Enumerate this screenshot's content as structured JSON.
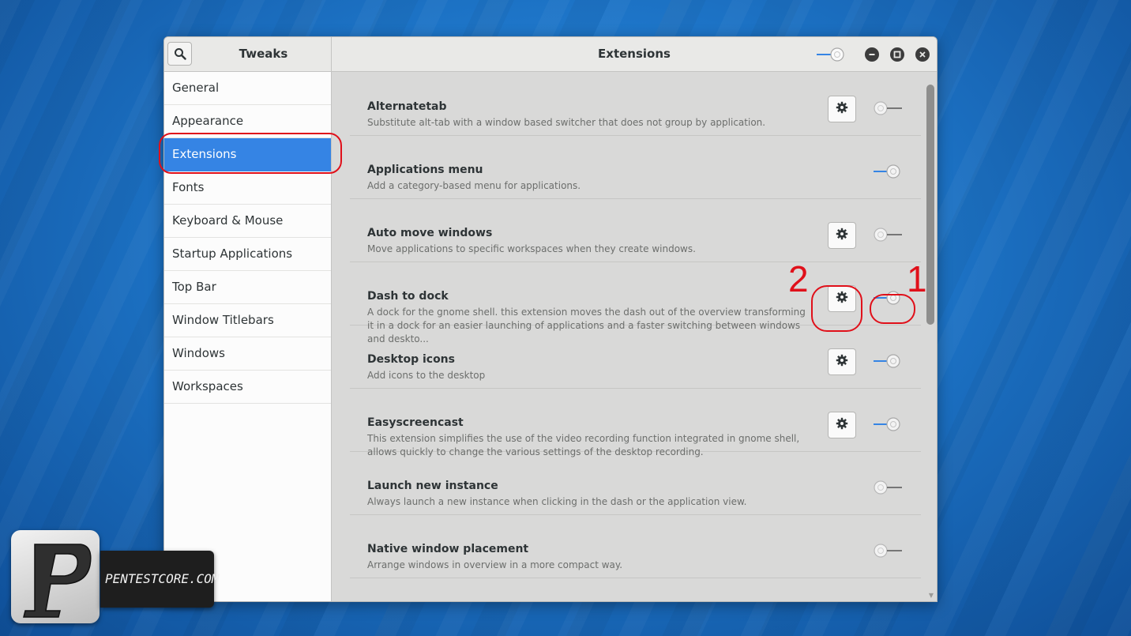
{
  "header": {
    "app_title": "Tweaks",
    "page_title": "Extensions",
    "global_switch": "off"
  },
  "sidebar": {
    "items": [
      {
        "label": "General",
        "active": false
      },
      {
        "label": "Appearance",
        "active": false
      },
      {
        "label": "Extensions",
        "active": true
      },
      {
        "label": "Fonts",
        "active": false
      },
      {
        "label": "Keyboard & Mouse",
        "active": false
      },
      {
        "label": "Startup Applications",
        "active": false
      },
      {
        "label": "Top Bar",
        "active": false
      },
      {
        "label": "Window Titlebars",
        "active": false
      },
      {
        "label": "Windows",
        "active": false
      },
      {
        "label": "Workspaces",
        "active": false
      }
    ]
  },
  "extensions": [
    {
      "name": "Alternatetab",
      "description": "Substitute alt-tab with a window based switcher that does not group by application.",
      "has_settings": true,
      "enabled": false
    },
    {
      "name": "Applications menu",
      "description": "Add a category-based menu for applications.",
      "has_settings": false,
      "enabled": true
    },
    {
      "name": "Auto move windows",
      "description": "Move applications to specific workspaces when they create windows.",
      "has_settings": true,
      "enabled": false
    },
    {
      "name": "Dash to dock",
      "description": "A dock for the gnome shell. this extension moves the dash out of the overview transforming it in a dock for an easier launching of applications and a faster switching between windows and deskto...",
      "has_settings": true,
      "enabled": true
    },
    {
      "name": "Desktop icons",
      "description": "Add icons to the desktop",
      "has_settings": true,
      "enabled": true
    },
    {
      "name": "Easyscreencast",
      "description": "This extension simplifies the use of the video recording function integrated in gnome shell, allows quickly to change the various settings of the desktop recording.",
      "has_settings": true,
      "enabled": true
    },
    {
      "name": "Launch new instance",
      "description": "Always launch a new instance when clicking in the dash or the application view.",
      "has_settings": false,
      "enabled": false
    },
    {
      "name": "Native window placement",
      "description": "Arrange windows in overview in a more compact way.",
      "has_settings": false,
      "enabled": false
    }
  ],
  "annotations": {
    "label_toggle": "1",
    "label_settings": "2",
    "color": "#e0101a"
  },
  "watermark": {
    "text": "PENTESTCORE.COM",
    "logo_letter": "P"
  },
  "colors": {
    "accent": "#3584e4",
    "toggle_on": "#3584e4",
    "toggle_off": "#a9a9a9"
  },
  "icons": {
    "search": "search-icon",
    "gear": "gear-icon",
    "minimize": "minimize-icon",
    "maximize": "maximize-icon",
    "close": "close-icon"
  }
}
